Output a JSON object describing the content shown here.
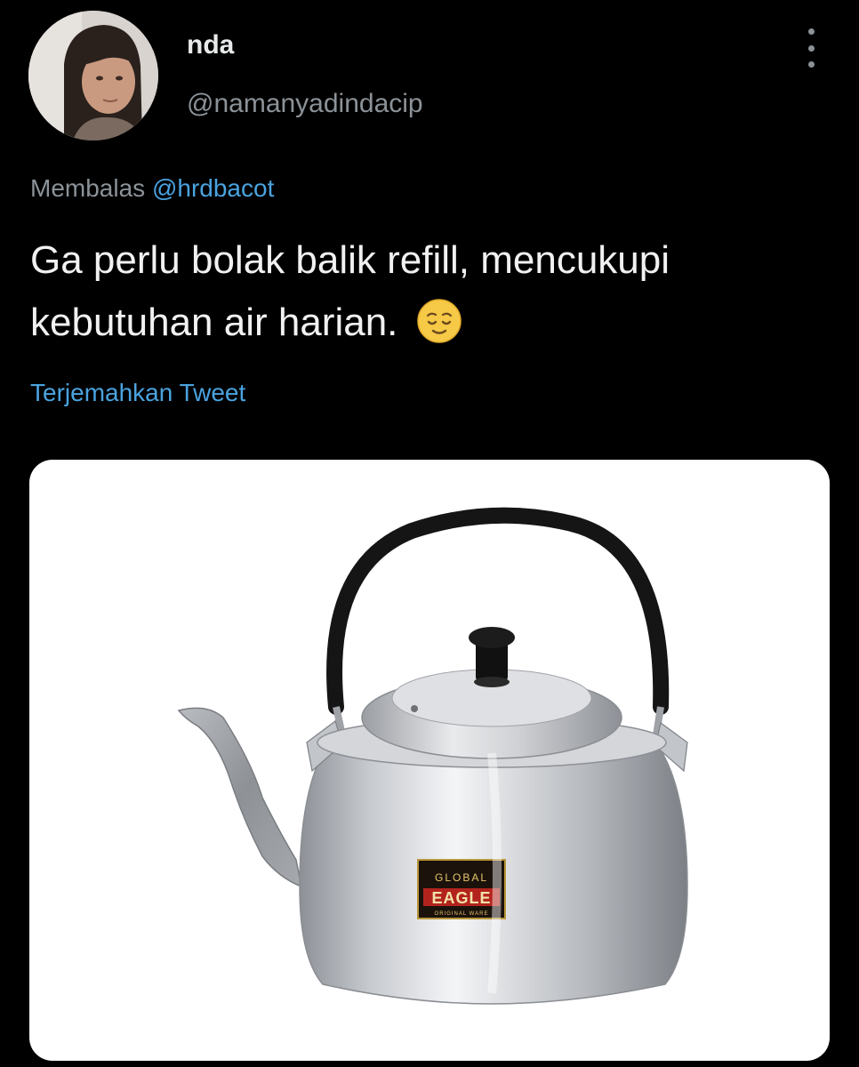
{
  "tweet": {
    "author": {
      "display_name": "nda",
      "handle": "@namanyadindacip"
    },
    "reply_prefix": "Membalas",
    "reply_to": "@hrdbacot",
    "text": "Ga perlu bolak balik refill, mencukupi kebutuhan air harian.",
    "emoji": "relieved-face",
    "translate_label": "Terjemahkan Tweet",
    "media": {
      "label_top": "GLOBAL",
      "label_main": "EAGLE",
      "label_sub": "ORIGINAL WARE"
    }
  },
  "colors": {
    "background": "#000000",
    "link": "#4aa3df",
    "muted": "#8b9298",
    "text": "#f1f1f1"
  }
}
